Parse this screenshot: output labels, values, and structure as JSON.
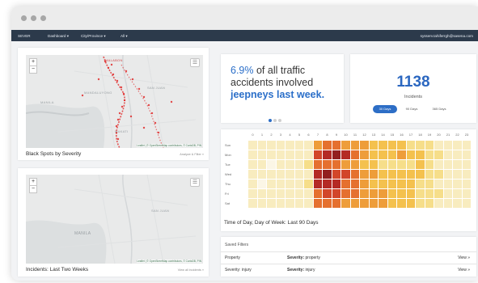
{
  "navbar": {
    "brand": "SEVER",
    "menu": [
      "Dashboard ▾",
      "City/Province ▾",
      "All ▾"
    ],
    "user": "sysserv.tahiferrgh@sasena.com"
  },
  "maps": [
    {
      "caption": "Black Spots by Severity",
      "link": "Analyze & Filter »",
      "labels": [
        "MANILA",
        "SAN JUAN",
        "MANDALUYONG",
        "MAKATI",
        "MALABON"
      ],
      "attribution": "Leaflet | © OpenStreetMap contributors, © CartoDB, PIN",
      "accent": "#e02020"
    },
    {
      "caption": "Incidents: Last Two Weeks",
      "link": "View all incidents »",
      "labels": [
        "MANILA",
        "SAN JUAN"
      ],
      "attribution": "Leaflet | © OpenStreetMap contributors, © CartoDB, PIN"
    }
  ],
  "map_controls": {
    "zoom_in": "+",
    "zoom_out": "−",
    "layers_icon": "layers-icon"
  },
  "stat_card": {
    "percent": "6.9%",
    "text1": " of all traffic accidents involved ",
    "vehicle": "jeepneys last week."
  },
  "incidents_card": {
    "count": "1138",
    "label": "Incidents",
    "tabs": [
      "30 Days",
      "90 Days",
      "365 Days"
    ],
    "active_tab": 0
  },
  "heatmap": {
    "caption": "Time of Day, Day of Week: Last 90 Days",
    "hours": [
      "0",
      "1",
      "2",
      "3",
      "4",
      "5",
      "6",
      "7",
      "8",
      "9",
      "10",
      "11",
      "12",
      "13",
      "14",
      "15",
      "16",
      "17",
      "18",
      "19",
      "20",
      "21",
      "22",
      "23"
    ],
    "days": [
      "Sun",
      "Mon",
      "Tue",
      "Wed",
      "Thu",
      "Fri",
      "Sat"
    ],
    "palette": [
      "#fbf6e6",
      "#f8ecbf",
      "#f6de8a",
      "#f4c14e",
      "#ee9d3a",
      "#e5702f",
      "#d2462a",
      "#b42a25",
      "#921f20"
    ],
    "values": [
      [
        1,
        1,
        1,
        1,
        1,
        1,
        1,
        4,
        5,
        5,
        4,
        4,
        4,
        3,
        3,
        3,
        3,
        2,
        2,
        2,
        1,
        1,
        1,
        1
      ],
      [
        1,
        1,
        1,
        1,
        1,
        1,
        1,
        6,
        7,
        8,
        7,
        5,
        4,
        3,
        3,
        3,
        4,
        3,
        3,
        2,
        2,
        1,
        1,
        1
      ],
      [
        1,
        1,
        0,
        1,
        1,
        1,
        2,
        5,
        5,
        5,
        4,
        4,
        3,
        3,
        2,
        2,
        2,
        2,
        3,
        2,
        1,
        1,
        1,
        1
      ],
      [
        1,
        1,
        1,
        1,
        1,
        1,
        1,
        7,
        8,
        6,
        6,
        5,
        4,
        4,
        3,
        3,
        3,
        3,
        3,
        2,
        2,
        1,
        1,
        1
      ],
      [
        1,
        0,
        1,
        1,
        1,
        1,
        2,
        7,
        7,
        7,
        5,
        5,
        4,
        3,
        3,
        3,
        3,
        3,
        2,
        2,
        1,
        1,
        1,
        1
      ],
      [
        1,
        1,
        1,
        1,
        1,
        1,
        1,
        5,
        6,
        6,
        5,
        5,
        4,
        4,
        4,
        3,
        3,
        3,
        2,
        2,
        2,
        1,
        1,
        1
      ],
      [
        1,
        1,
        1,
        1,
        1,
        1,
        1,
        5,
        5,
        5,
        4,
        4,
        4,
        4,
        4,
        3,
        3,
        3,
        2,
        2,
        1,
        1,
        1,
        1
      ]
    ]
  },
  "saved_filters": {
    "title": "Saved Filters",
    "rows": [
      {
        "name": "Property",
        "filter_label": "Severity:",
        "filter_value": "property",
        "action": "View »"
      },
      {
        "name": "Severity: injury",
        "filter_label": "Severity:",
        "filter_value": "injury",
        "action": "View »"
      }
    ]
  }
}
